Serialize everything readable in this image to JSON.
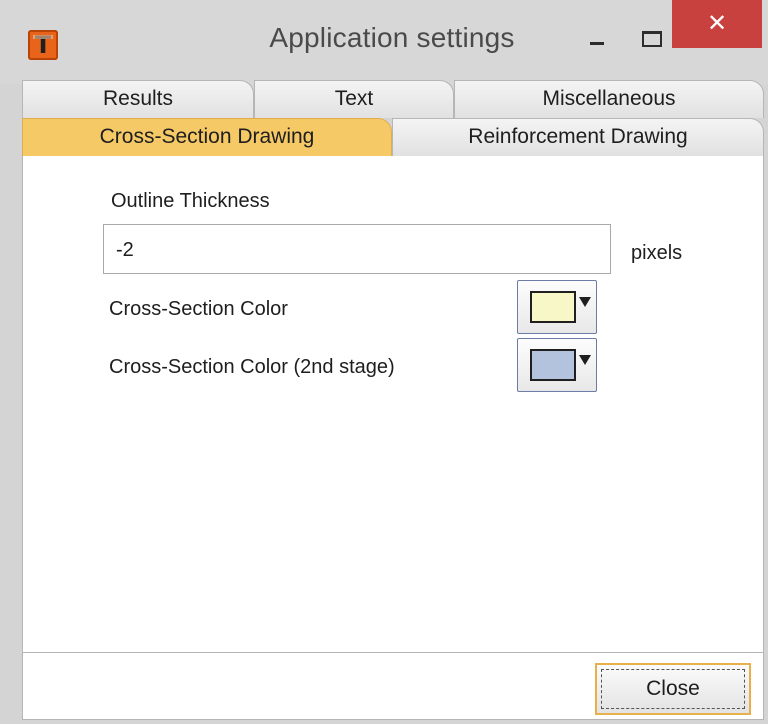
{
  "window": {
    "title": "Application settings",
    "icon": {
      "name": "app-logo-icon",
      "glyph": "T",
      "color": "#e8641a"
    },
    "controls": {
      "minimize": "minimize-icon",
      "maximize": "maximize-icon",
      "close": "close-icon",
      "close_glyph": "✕",
      "close_color": "#c9413f"
    }
  },
  "tabs": {
    "row1": [
      {
        "label": "Results"
      },
      {
        "label": "Text"
      },
      {
        "label": "Miscellaneous"
      }
    ],
    "row2": [
      {
        "label": "Cross-Section Drawing",
        "active": true
      },
      {
        "label": "Reinforcement Drawing"
      }
    ],
    "active_color": "#f6c967"
  },
  "content": {
    "outline_thickness": {
      "label": "Outline Thickness",
      "value": "-2",
      "unit": "pixels"
    },
    "cross_section_color": {
      "label": "Cross-Section Color",
      "color": "#f7f7c8"
    },
    "cross_section_color_2nd": {
      "label": "Cross-Section Color (2nd stage)",
      "color": "#b3c3dd"
    }
  },
  "footer": {
    "close_label": "Close"
  }
}
